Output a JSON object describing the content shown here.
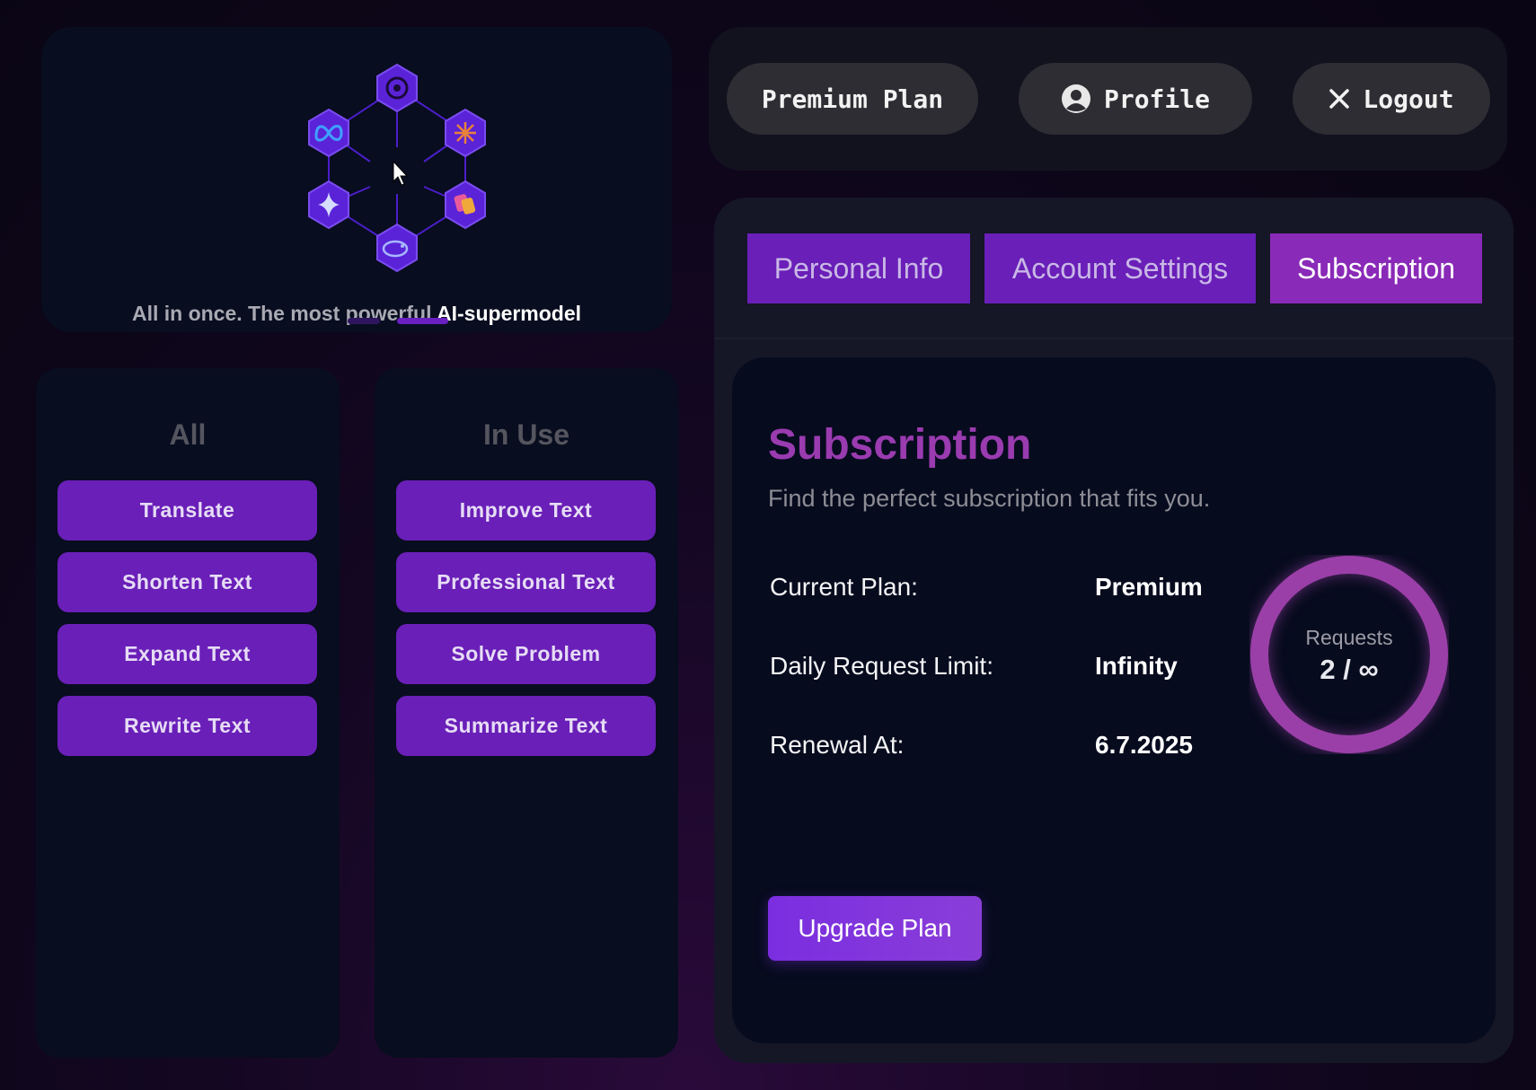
{
  "hero": {
    "caption_prefix": "All in once. The most powerful ",
    "caption_highlight": "AI-supermodel",
    "model_icons": [
      "openai-icon",
      "claude-icon",
      "copilot-icon",
      "deepseek-icon",
      "gemini-icon",
      "meta-icon"
    ],
    "carousel_active_index": 2,
    "carousel_count": 2
  },
  "columns": {
    "all": {
      "title": "All",
      "items": [
        "Translate",
        "Shorten Text",
        "Expand Text",
        "Rewrite Text"
      ]
    },
    "in_use": {
      "title": "In Use",
      "items": [
        "Improve Text",
        "Professional Text",
        "Solve Problem",
        "Summarize Text"
      ]
    }
  },
  "topnav": {
    "premium_label": "Premium Plan",
    "profile_label": "Profile",
    "logout_label": "Logout"
  },
  "tabs": {
    "personal": "Personal Info",
    "account": "Account Settings",
    "subscription": "Subscription",
    "active": "subscription"
  },
  "subscription": {
    "title": "Subscription",
    "subtitle": "Find the perfect subscription that fits you.",
    "rows": [
      {
        "label": "Current Plan:",
        "value": "Premium"
      },
      {
        "label": "Daily Request Limit:",
        "value": "Infinity"
      },
      {
        "label": "Renewal At:",
        "value": "6.7.2025"
      }
    ],
    "requests_label": "Requests",
    "requests_value": "2 / ∞",
    "upgrade_label": "Upgrade Plan"
  },
  "colors": {
    "accent": "#6a1fb8",
    "accent_active": "#8a2ab8",
    "title": "#9a3bb0",
    "ring": "#9b3fa8"
  }
}
